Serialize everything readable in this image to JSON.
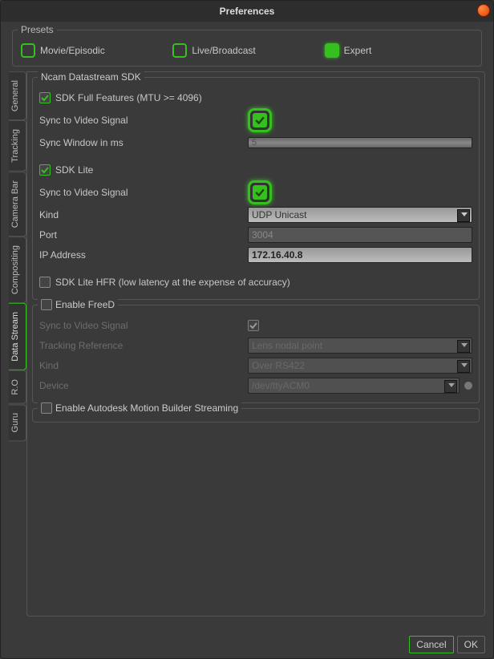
{
  "window": {
    "title": "Preferences"
  },
  "presets": {
    "group_label": "Presets",
    "movie": "Movie/Episodic",
    "live": "Live/Broadcast",
    "expert": "Expert"
  },
  "tabs": {
    "general": "General",
    "tracking": "Tracking",
    "camera_bar": "Camera Bar",
    "compositing": "Compositing",
    "data_stream": "Data Stream",
    "ro": "R.O",
    "guru": "Guru"
  },
  "sdk": {
    "group_label": "Ncam Datastream SDK",
    "full_features": "SDK Full Features (MTU >= 4096)",
    "sync_video1": "Sync to Video Signal",
    "sync_window_label": "Sync Window in ms",
    "sync_window_value": "5",
    "lite_label": "SDK Lite",
    "sync_video2": "Sync to Video Signal",
    "kind_label": "Kind",
    "kind_value": "UDP Unicast",
    "port_label": "Port",
    "port_value": "3004",
    "ip_label": "IP Address",
    "ip_value": "172.16.40.8",
    "hfr_label": "SDK Lite HFR (low latency at the expense of accuracy)"
  },
  "freed": {
    "group_label": "Enable FreeD",
    "sync_video": "Sync to Video Signal",
    "ref_label": "Tracking Reference",
    "ref_value": "Lens nodal point",
    "kind_label": "Kind",
    "kind_value": "Over RS422",
    "device_label": "Device",
    "device_value": "/dev/ttyACM0"
  },
  "amb": {
    "group_label": "Enable Autodesk Motion Builder Streaming"
  },
  "buttons": {
    "cancel": "Cancel",
    "ok": "OK"
  }
}
